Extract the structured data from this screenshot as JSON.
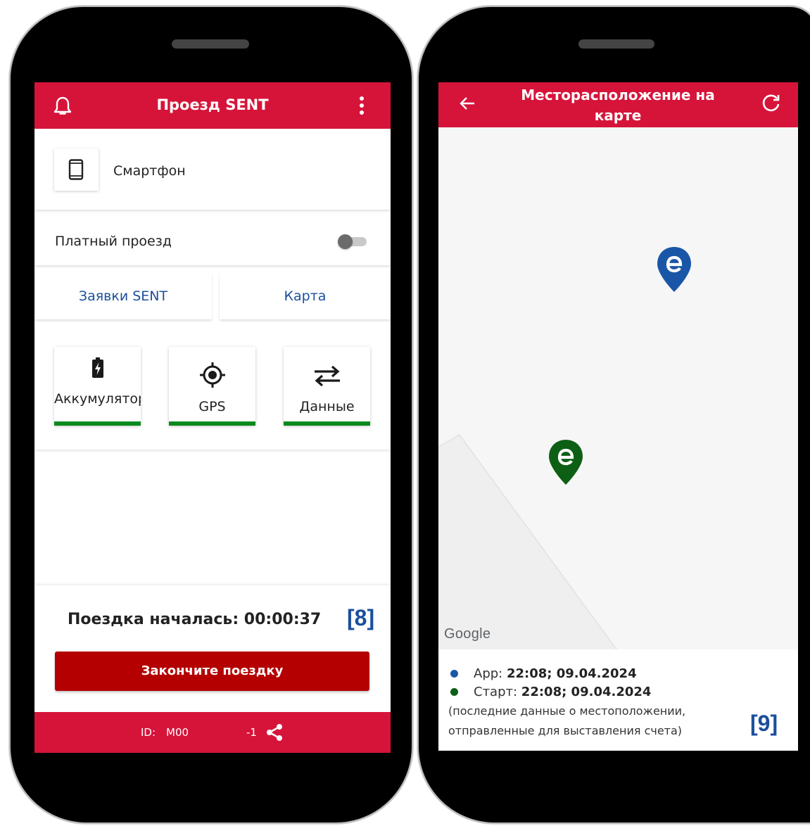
{
  "left_phone": {
    "header": {
      "title": "Проезд SENT",
      "bell_icon": "bell-icon",
      "menu_icon": "more-vertical-icon"
    },
    "device": {
      "icon": "smartphone-icon",
      "label": "Смартфон"
    },
    "toll": {
      "label": "Платный проезд",
      "enabled": false
    },
    "buttons": {
      "requests": "Заявки SENT",
      "map": "Карта"
    },
    "status": [
      {
        "name": "battery",
        "icon": "battery-charging-icon",
        "label": "Аккумулятор",
        "ok": true
      },
      {
        "name": "gps",
        "icon": "gps-target-icon",
        "label": "GPS",
        "ok": true
      },
      {
        "name": "data",
        "icon": "swap-arrows-icon",
        "label": "Данные",
        "ok": true
      }
    ],
    "trip": {
      "status_text": "Поездка началась: 00:00:37",
      "end_button": "Закончите поездку"
    },
    "footer": {
      "id_label": "ID:",
      "id_value": "M00",
      "id_suffix": "-1",
      "share_icon": "share-icon"
    },
    "tag": "[8]"
  },
  "right_phone": {
    "header": {
      "title": "Месторасположение на карте",
      "back_icon": "arrow-left-icon",
      "refresh_icon": "refresh-icon"
    },
    "map": {
      "provider_logo": "Google",
      "markers": [
        {
          "color": "#1a56a8"
        },
        {
          "color": "#0c5f14"
        }
      ]
    },
    "legend": {
      "app_label": "App:",
      "app_value": "22:08; 09.04.2024",
      "start_label": "Старт:",
      "start_value": "22:08; 09.04.2024",
      "note_line1": "(последние данные о местоположении,",
      "note_line2": "отправленные для выставления счета)"
    },
    "tag": "[9]"
  },
  "colors": {
    "brand_red": "#d6143a",
    "dark_red_button": "#b40000",
    "status_green": "#0a8a1e",
    "marker_blue": "#1a56a8",
    "marker_green": "#0c5f14",
    "tag_blue": "#1b4f9c"
  }
}
